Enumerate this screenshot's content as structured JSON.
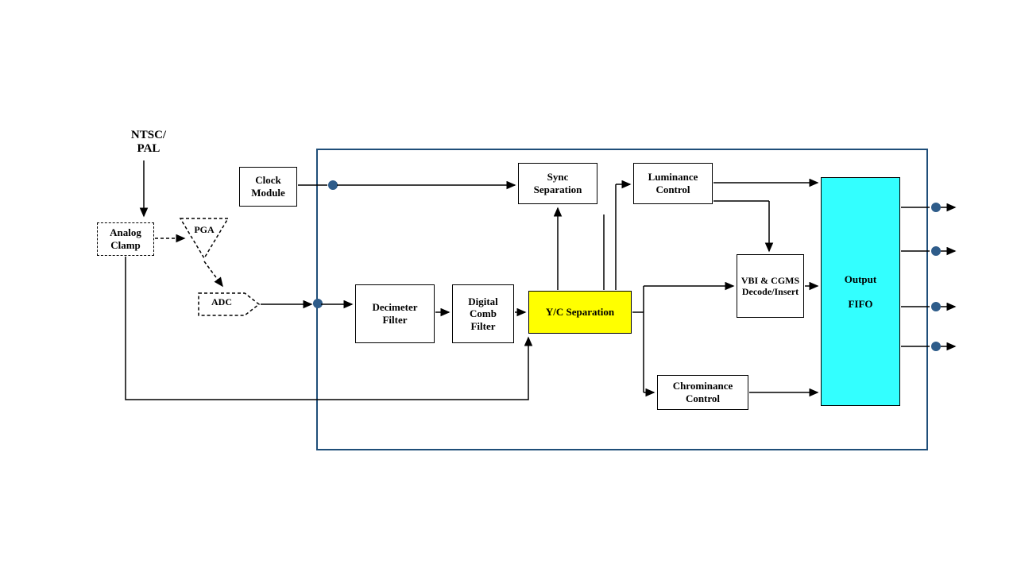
{
  "input_label_top": "NTSC/",
  "input_label_bottom": "PAL",
  "blocks": {
    "analog_clamp": "Analog Clamp",
    "pga": "PGA",
    "adc": "ADC",
    "clock_module": "Clock Module",
    "decimeter_filter": "Decimeter Filter",
    "digital_comb_filter": "Digital Comb Filter",
    "yc_separation": "Y/C Separation",
    "sync_separation": "Sync Separation",
    "luminance_control": "Luminance Control",
    "vbi_cgms": "VBI & CGMS Decode/Insert",
    "chrominance_control": "Chrominance Control",
    "output_fifo_top": "Output",
    "output_fifo_bottom": "FIFO"
  }
}
